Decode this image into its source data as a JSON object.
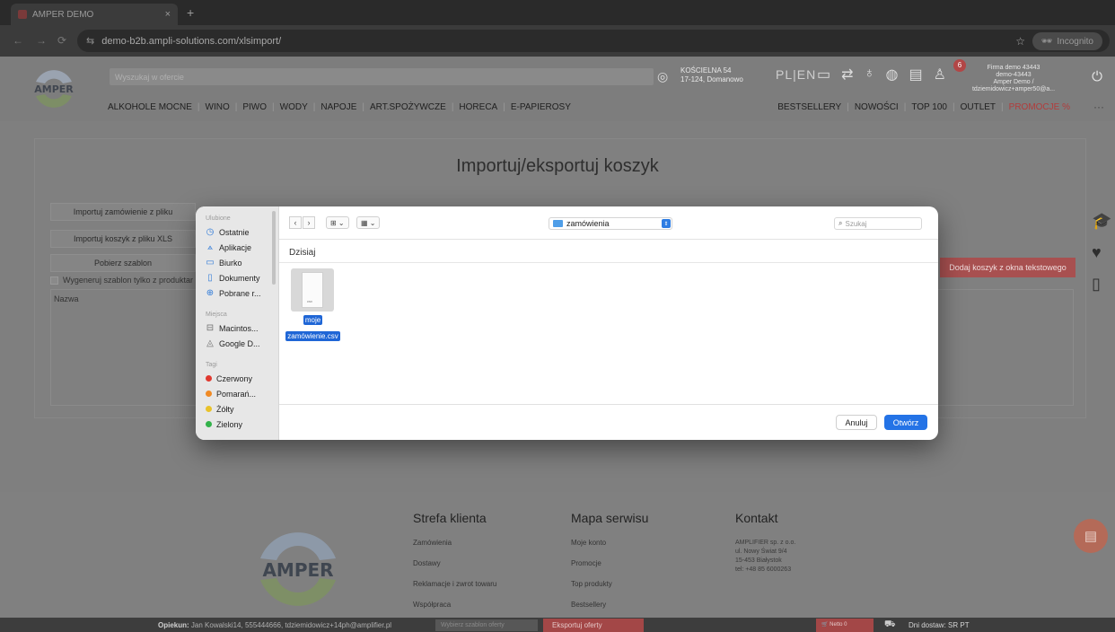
{
  "browser": {
    "tab_title": "AMPER DEMO",
    "tab_close": "×",
    "tab_new": "+",
    "back": "←",
    "forward": "→",
    "reload": "⟳",
    "url": "demo-b2b.ampli-solutions.com/xlsimport/",
    "bookmark": "☆",
    "incognito": "Incognito"
  },
  "header": {
    "search_placeholder": "Wyszukaj w ofercie",
    "location_line1": "KOŚCIELNA 54",
    "location_line2": "17-124, Domanowo",
    "lang": "PL|EN",
    "badge_count": "6",
    "firm_line1": "Firma demo 43443",
    "firm_line2": "demo-43443",
    "firm_line3": "Amper Demo / tdziemidowicz+amper50@a...",
    "menu_left": [
      "ALKOHOLE MOCNE",
      "WINO",
      "PIWO",
      "WODY",
      "NAPOJE",
      "ART.SPOŻYWCZE",
      "HORECA",
      "E-PAPIEROSY"
    ],
    "menu_right": [
      "BESTSELLERY",
      "NOWOŚCI",
      "TOP 100",
      "OUTLET",
      "PROMOCJE %"
    ],
    "more": "···"
  },
  "main": {
    "title": "Importuj/eksportuj koszyk",
    "import_order": "Importuj zamówienie z pliku",
    "import_cart": "Importuj koszyk z pliku XLS",
    "download_template": "Pobierz szablon",
    "checkbox_label": "Wygeneruj szablon tylko z produktar",
    "column_name": "Nazwa",
    "add_cart_text": "Dodaj koszyk z okna tekstowego"
  },
  "dialog": {
    "sidebar": {
      "favorites_title": "Ulubione",
      "favorites": [
        {
          "label": "Ostatnie",
          "icon": "clock-icon"
        },
        {
          "label": "Aplikacje",
          "icon": "apps-icon"
        },
        {
          "label": "Biurko",
          "icon": "desktop-icon"
        },
        {
          "label": "Dokumenty",
          "icon": "document-icon"
        },
        {
          "label": "Pobrane r...",
          "icon": "download-icon"
        }
      ],
      "places_title": "Miejsca",
      "places": [
        {
          "label": "Macintos...",
          "icon": "disk-icon"
        },
        {
          "label": "Google D...",
          "icon": "drive-icon"
        }
      ],
      "tags_title": "Tagi",
      "tags": [
        {
          "label": "Czerwony",
          "color": "#e0392f"
        },
        {
          "label": "Pomarań...",
          "color": "#f08a24"
        },
        {
          "label": "Żółty",
          "color": "#e9c22a"
        },
        {
          "label": "Zielony",
          "color": "#33b24a"
        }
      ]
    },
    "location": "zamówienia",
    "search_placeholder": "Szukaj",
    "section_today": "Dzisiaj",
    "file_name_line1": "moje",
    "file_name_line2": "zamówienie.csv",
    "file_type": "csv",
    "cancel": "Anuluj",
    "open": "Otwórz"
  },
  "footer": {
    "col1_title": "Strefa klienta",
    "col1_links": [
      "Zamówienia",
      "Dostawy",
      "Reklamacje i zwrot towaru",
      "Współpraca"
    ],
    "col2_title": "Mapa serwisu",
    "col2_links": [
      "Moje konto",
      "Promocje",
      "Top produkty",
      "Bestsellery"
    ],
    "col3_title": "Kontakt",
    "contact_lines": [
      "AMPLIFIER sp. z o.o.",
      "ul. Nowy Świat 9/4",
      "15-453 Białystok",
      "tel: +48 85 6000263"
    ]
  },
  "bottombar": {
    "opiekun_label": "Opiekun:",
    "opiekun_value": "Jan Kowalski14, 555444666, tdziemidowicz+14ph@amplifier.pl",
    "template_select": "Wybierz szablon oferty",
    "export_offers": "Eksportuj oferty",
    "cart_label": "Netto 0",
    "delivery_days": "Dni dostaw: SR PT"
  },
  "colors": {
    "accent_blue": "#2473e6",
    "promo_red": "#b23c3c"
  }
}
